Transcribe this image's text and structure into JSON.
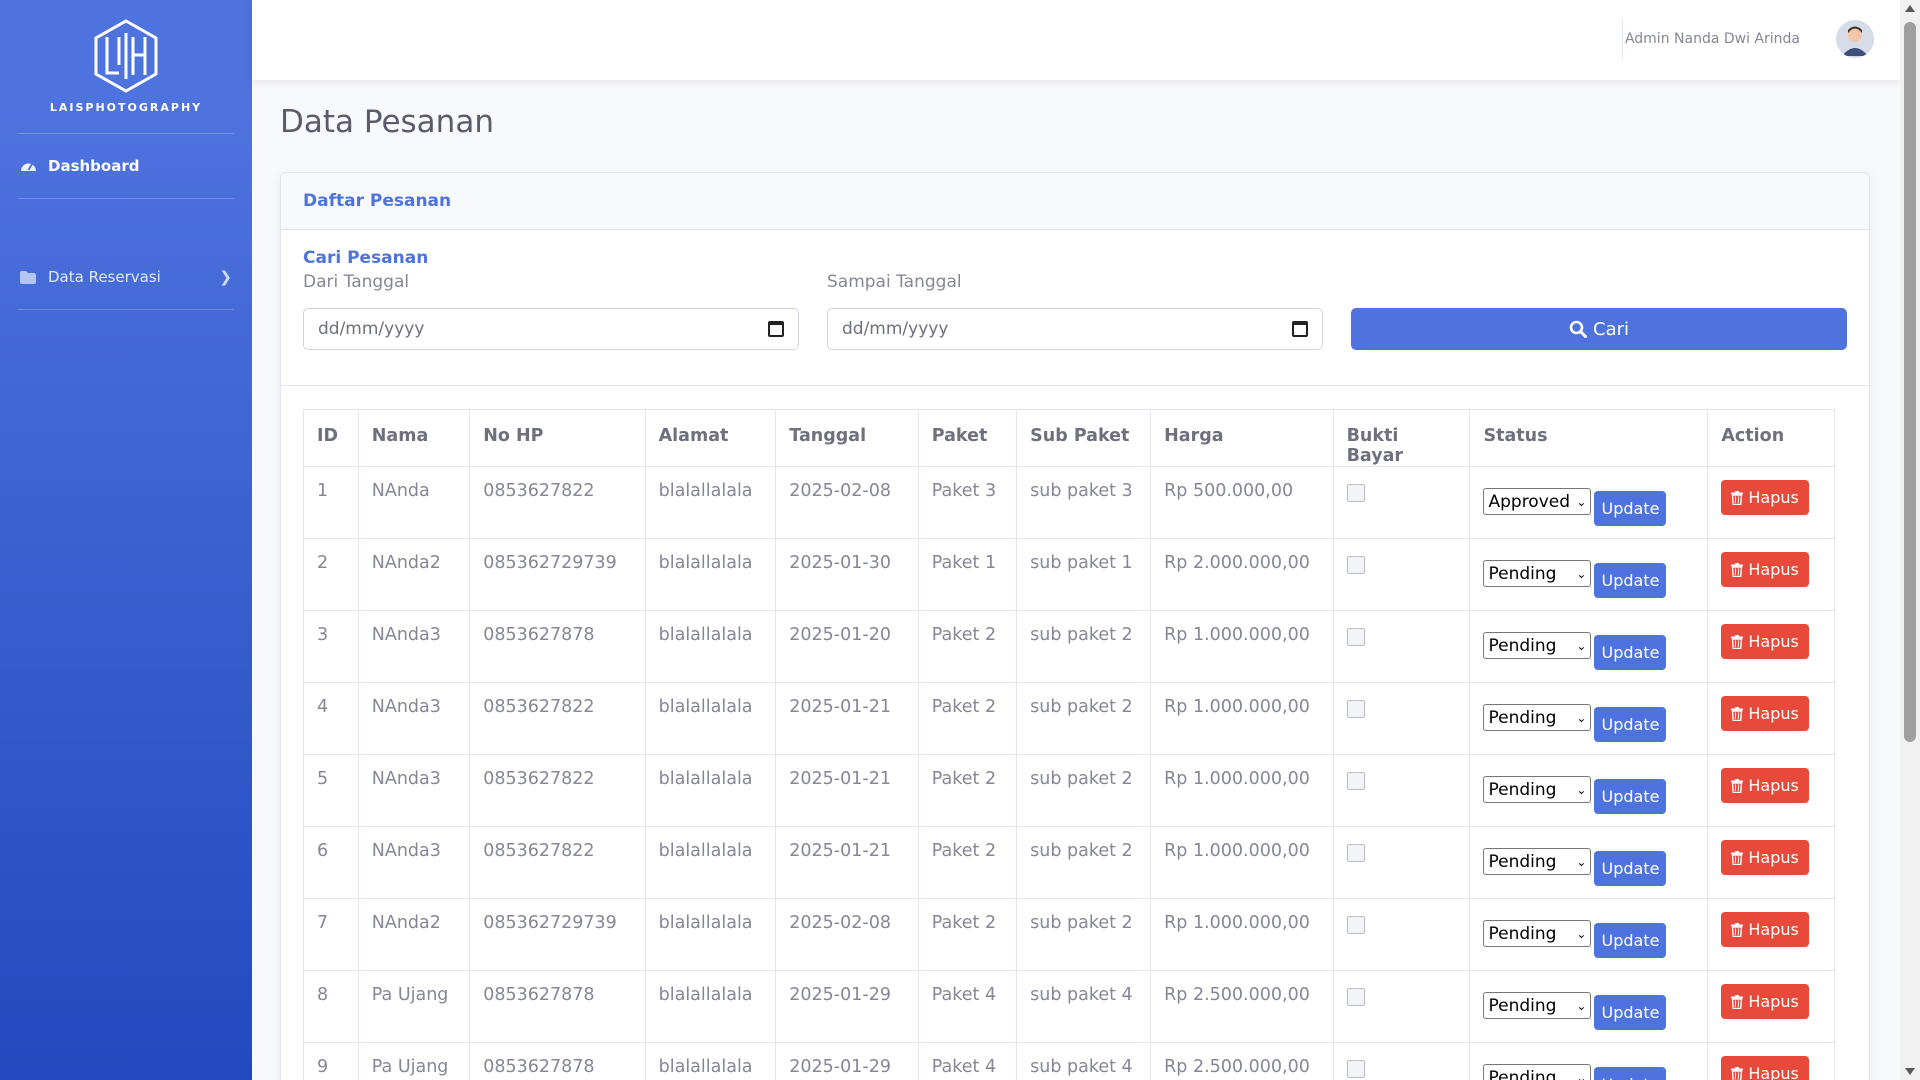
{
  "brand": {
    "name": "LAISPHOTOGRAPHY"
  },
  "sidebar": {
    "items": [
      {
        "label": "Dashboard",
        "icon": "tachometer-icon"
      },
      {
        "label": "Data Reservasi",
        "icon": "folder-icon"
      }
    ]
  },
  "topbar": {
    "user_name": "Admin Nanda Dwi Arinda"
  },
  "page": {
    "title": "Data Pesanan"
  },
  "card": {
    "header": "Daftar Pesanan",
    "search": {
      "title": "Cari Pesanan",
      "from_label": "Dari Tanggal",
      "to_label": "Sampai Tanggal",
      "from_placeholder": "dd/mm/yyyy",
      "to_placeholder": "dd/mm/yyyy",
      "button_label": "Cari"
    }
  },
  "table": {
    "headers": [
      "ID",
      "Nama",
      "No HP",
      "Alamat",
      "Tanggal",
      "Paket",
      "Sub Paket",
      "Harga",
      "Bukti Bayar",
      "Status",
      "Action"
    ],
    "update_label": "Update",
    "delete_label": "Hapus",
    "rows": [
      {
        "id": "1",
        "nama": "NAnda",
        "hp": "0853627822",
        "alamat": "blalallalala",
        "tanggal": "2025-02-08",
        "paket": "Paket 3",
        "sub": "sub paket 3",
        "harga": "Rp 500.000,00",
        "status": "Approved"
      },
      {
        "id": "2",
        "nama": "NAnda2",
        "hp": "085362729739",
        "alamat": "blalallalala",
        "tanggal": "2025-01-30",
        "paket": "Paket 1",
        "sub": "sub paket 1",
        "harga": "Rp 2.000.000,00",
        "status": "Pending"
      },
      {
        "id": "3",
        "nama": "NAnda3",
        "hp": "0853627878",
        "alamat": "blalallalala",
        "tanggal": "2025-01-20",
        "paket": "Paket 2",
        "sub": "sub paket 2",
        "harga": "Rp 1.000.000,00",
        "status": "Pending"
      },
      {
        "id": "4",
        "nama": "NAnda3",
        "hp": "0853627822",
        "alamat": "blalallalala",
        "tanggal": "2025-01-21",
        "paket": "Paket 2",
        "sub": "sub paket 2",
        "harga": "Rp 1.000.000,00",
        "status": "Pending"
      },
      {
        "id": "5",
        "nama": "NAnda3",
        "hp": "0853627822",
        "alamat": "blalallalala",
        "tanggal": "2025-01-21",
        "paket": "Paket 2",
        "sub": "sub paket 2",
        "harga": "Rp 1.000.000,00",
        "status": "Pending"
      },
      {
        "id": "6",
        "nama": "NAnda3",
        "hp": "0853627822",
        "alamat": "blalallalala",
        "tanggal": "2025-01-21",
        "paket": "Paket 2",
        "sub": "sub paket 2",
        "harga": "Rp 1.000.000,00",
        "status": "Pending"
      },
      {
        "id": "7",
        "nama": "NAnda2",
        "hp": "085362729739",
        "alamat": "blalallalala",
        "tanggal": "2025-02-08",
        "paket": "Paket 2",
        "sub": "sub paket 2",
        "harga": "Rp 1.000.000,00",
        "status": "Pending"
      },
      {
        "id": "8",
        "nama": "Pa Ujang",
        "hp": "0853627878",
        "alamat": "blalallalala",
        "tanggal": "2025-01-29",
        "paket": "Paket 4",
        "sub": "sub paket 4",
        "harga": "Rp 2.500.000,00",
        "status": "Pending"
      },
      {
        "id": "9",
        "nama": "Pa Ujang",
        "hp": "0853627878",
        "alamat": "blalallalala",
        "tanggal": "2025-01-29",
        "paket": "Paket 4",
        "sub": "sub paket 4",
        "harga": "Rp 2.500.000,00",
        "status": "Pending"
      }
    ]
  },
  "colors": {
    "primary": "#4e73df",
    "danger": "#e74a3b",
    "sidebar_bottom": "#224abe"
  }
}
